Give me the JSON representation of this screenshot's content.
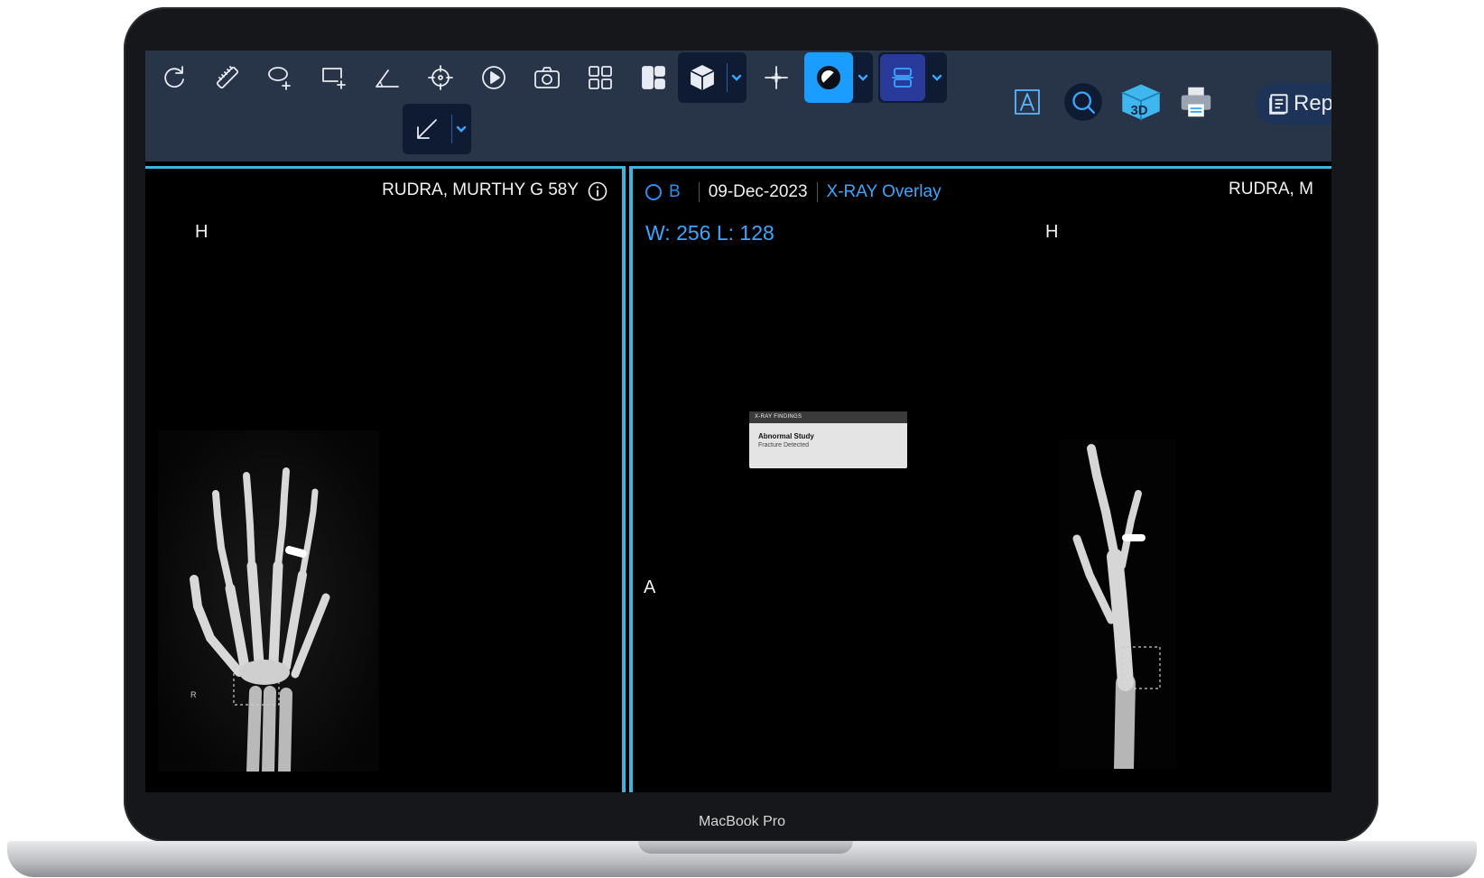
{
  "device": {
    "label": "MacBook Pro"
  },
  "toolbar": {
    "tools": [
      {
        "name": "rotate-icon"
      },
      {
        "name": "ruler-icon"
      },
      {
        "name": "ellipse-add-icon"
      },
      {
        "name": "rectangle-add-icon"
      },
      {
        "name": "angle-icon"
      },
      {
        "name": "crosshair-icon"
      },
      {
        "name": "play-icon"
      },
      {
        "name": "camera-icon"
      },
      {
        "name": "grid-layout-icon"
      },
      {
        "name": "layout-icon"
      },
      {
        "name": "cube-icon"
      },
      {
        "name": "move-cross-icon"
      },
      {
        "name": "contrast-icon"
      },
      {
        "name": "stack-icon"
      },
      {
        "name": "arrow-annotate-icon"
      },
      {
        "name": "text-annotation-icon"
      },
      {
        "name": "search-icon"
      },
      {
        "name": "3d-icon"
      },
      {
        "name": "print-icon"
      }
    ],
    "three_d_label": "3D",
    "report_label": "Rep",
    "accent_color": "#1a9dff"
  },
  "viewer": {
    "left": {
      "patient": "RUDRA, MURTHY G 58Y",
      "orientation_top": "H",
      "marker": "R"
    },
    "right": {
      "series_letter": "B",
      "date": "09-Dec-2023",
      "overlay": "X-RAY Overlay",
      "window_level": "W: 256  L: 128",
      "patient": "RUDRA, M",
      "orientation_top": "H",
      "orientation_left": "A",
      "findings": {
        "header": "X-RAY FINDINGS",
        "title": "Abnormal Study",
        "subtitle": "Fracture Detected"
      }
    },
    "border_color": "#3fb3de"
  }
}
